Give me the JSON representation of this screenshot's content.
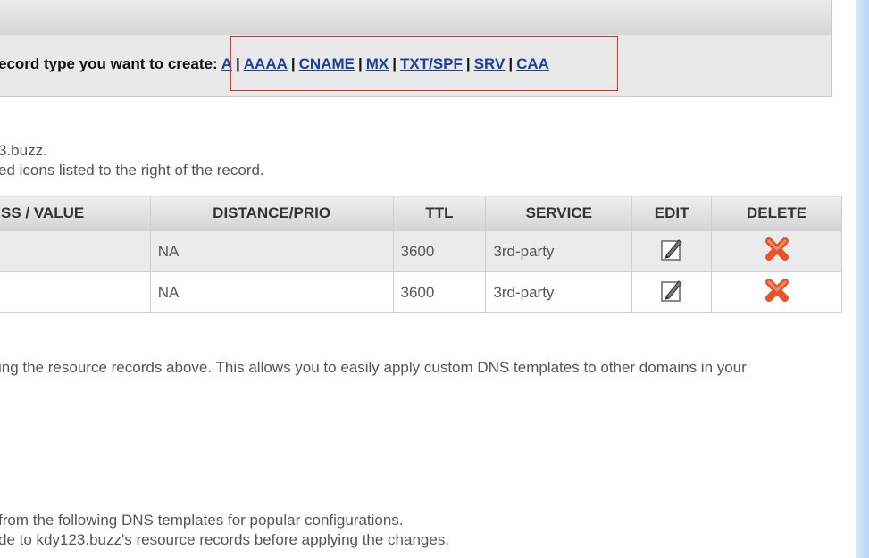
{
  "record_type_bar": {
    "prompt": "ecord type you want to create:",
    "types": [
      {
        "label": "A"
      },
      {
        "label": "AAAA"
      },
      {
        "label": "CNAME"
      },
      {
        "label": "MX"
      },
      {
        "label": "TXT/SPF"
      },
      {
        "label": "SRV"
      },
      {
        "label": "CAA"
      }
    ],
    "separator": "|"
  },
  "info": {
    "line1": "3.buzz.",
    "line2": "ed icons listed to the right of the record."
  },
  "records_table": {
    "headers": [
      "SS / VALUE",
      "DISTANCE/PRIO",
      "TTL",
      "SERVICE",
      "EDIT",
      "DELETE"
    ],
    "rows": [
      {
        "value": "",
        "prio": "NA",
        "ttl": "3600",
        "service": "3rd-party"
      },
      {
        "value": "",
        "prio": "NA",
        "ttl": "3600",
        "service": "3rd-party"
      }
    ],
    "icons": {
      "edit": "edit-icon",
      "delete": "delete-icon"
    }
  },
  "template_note": "ing the resource records above. This allows you to easily apply custom DNS templates to other domains in your",
  "templates_info": {
    "line1": "from the following DNS templates for popular configurations.",
    "line2": "de to kdy123.buzz's resource records before applying the changes."
  },
  "colors": {
    "link": "#1e3f99",
    "highlight": "#e03030",
    "delete": "#e8542a"
  }
}
